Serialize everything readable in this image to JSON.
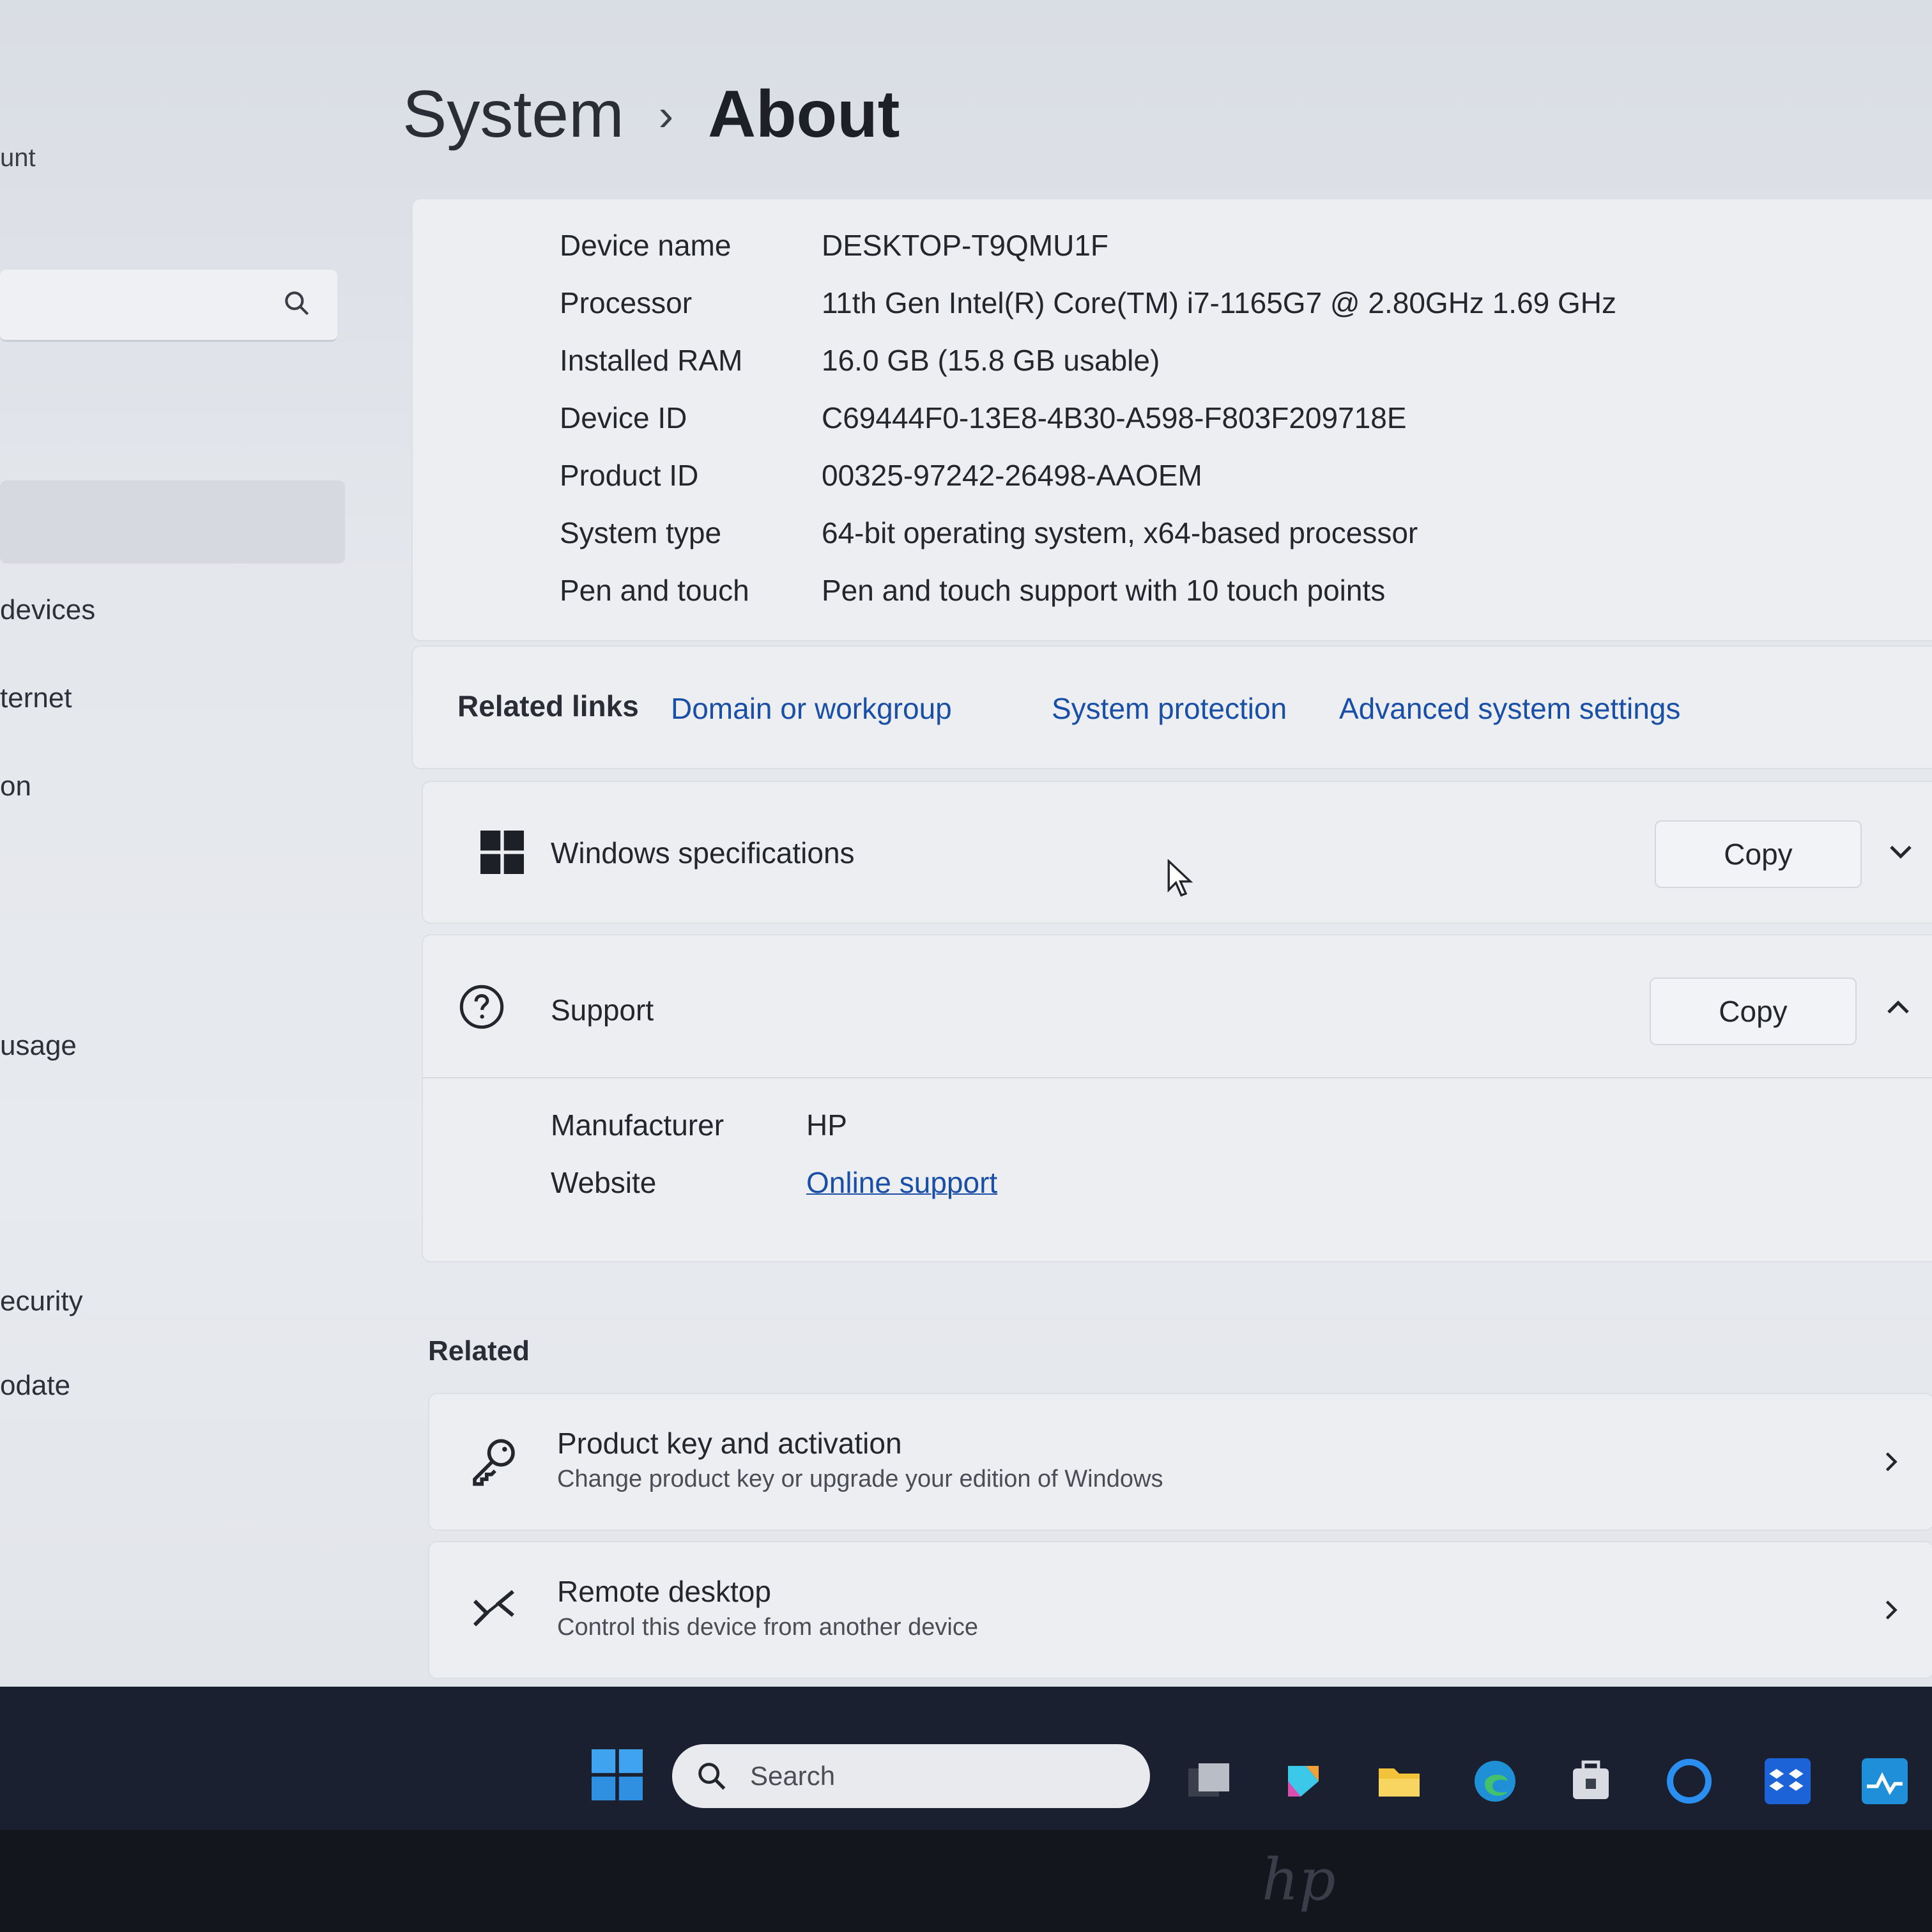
{
  "sidebar": {
    "account_fragment": "unt",
    "items": [
      {
        "label": "devices"
      },
      {
        "label": "ternet"
      },
      {
        "label": "on"
      },
      {
        "label": "usage"
      },
      {
        "label": "ecurity"
      },
      {
        "label": "odate"
      }
    ]
  },
  "breadcrumb": {
    "parent": "System",
    "separator": "›",
    "current": "About"
  },
  "specs": [
    {
      "label": "Device name",
      "value": "DESKTOP-T9QMU1F"
    },
    {
      "label": "Processor",
      "value": "11th Gen Intel(R) Core(TM) i7-1165G7 @ 2.80GHz   1.69 GHz"
    },
    {
      "label": "Installed RAM",
      "value": "16.0 GB (15.8 GB usable)"
    },
    {
      "label": "Device ID",
      "value": "C69444F0-13E8-4B30-A598-F803F209718E"
    },
    {
      "label": "Product ID",
      "value": "00325-97242-26498-AAOEM"
    },
    {
      "label": "System type",
      "value": "64-bit operating system, x64-based processor"
    },
    {
      "label": "Pen and touch",
      "value": "Pen and touch support with 10 touch points"
    }
  ],
  "related_links": {
    "title": "Related links",
    "links": [
      "Domain or workgroup",
      "System protection",
      "Advanced system settings"
    ]
  },
  "windows_specifications": {
    "title": "Windows specifications",
    "copy_label": "Copy"
  },
  "support": {
    "title": "Support",
    "copy_label": "Copy",
    "manufacturer_label": "Manufacturer",
    "manufacturer_value": "HP",
    "website_label": "Website",
    "website_value": "Online support"
  },
  "related": {
    "heading": "Related",
    "items": [
      {
        "title": "Product key and activation",
        "subtitle": "Change product key or upgrade your edition of Windows",
        "icon": "key-icon"
      },
      {
        "title": "Remote desktop",
        "subtitle": "Control this device from another device",
        "icon": "remote-desktop-icon"
      }
    ]
  },
  "taskbar": {
    "search_placeholder": "Search",
    "icons": [
      "start-icon",
      "task-view-icon",
      "copilot-icon",
      "file-explorer-icon",
      "edge-icon",
      "store-icon",
      "cortana-icon",
      "dropbox-icon",
      "app-icon"
    ]
  },
  "colors": {
    "accent_link": "#1a4fa8",
    "window_bg": "#e4e7ec",
    "taskbar_bg": "#1b2030"
  }
}
